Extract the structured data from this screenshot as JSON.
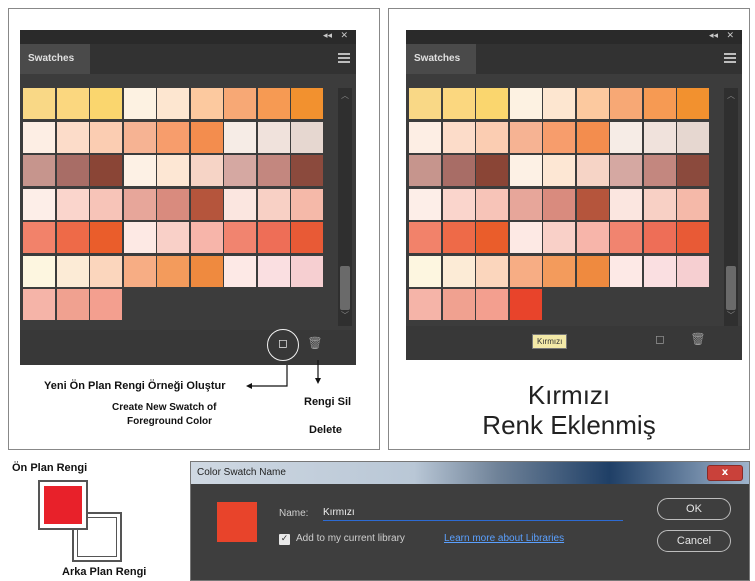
{
  "left_panel": {
    "tab_label": "Swatches",
    "ctrl_collapse": "◂◂",
    "ctrl_close": "✕",
    "swatches": [
      [
        "#f9d886",
        "#fbd77f",
        "#fad66e",
        "#fdf2e2",
        "#fde6d0",
        "#fcc99f",
        "#f7a875",
        "#f69a53",
        "#f2912f"
      ],
      [
        "#fdeee4",
        "#fcdcc9",
        "#fbcdb2",
        "#f6b393",
        "#f79d6c",
        "#f38d4e",
        "#f6ece6",
        "#f0e2dc",
        "#e6d7d0"
      ],
      [
        "#c6958d",
        "#a86d66",
        "#8a4536",
        "#fdf1e5",
        "#fde7d4",
        "#f6d4c6",
        "#d5a8a2",
        "#c3877f",
        "#8b4a3d"
      ],
      [
        "#fdeee8",
        "#fad5cc",
        "#f7c4b8",
        "#e7a69a",
        "#d98b7e",
        "#b5553c",
        "#fbe6e0",
        "#f8d0c5",
        "#f5b9a9"
      ],
      [
        "#f2826a",
        "#ee6a48",
        "#ea5d2b",
        "#fde9e4",
        "#f9d0c8",
        "#f7b5aa",
        "#f1846f",
        "#ee6e57",
        "#e85a36"
      ],
      [
        "#fdf6e0",
        "#fcebd6",
        "#fbd6bd",
        "#f7ad84",
        "#f39b5c",
        "#ef8a3f",
        "#fde9e6",
        "#fadfe1",
        "#f6cfd1"
      ],
      [
        "#f5b4a8",
        "#f0a190",
        "#f39f8f"
      ]
    ],
    "circle_icon": "new-swatch"
  },
  "right_panel": {
    "tab_label": "Swatches",
    "ctrl_collapse": "◂◂",
    "ctrl_close": "✕",
    "swatches": [
      [
        "#f9d886",
        "#fbd77f",
        "#fad66e",
        "#fdf2e2",
        "#fde6d0",
        "#fcc99f",
        "#f7a875",
        "#f69a53",
        "#f2912f"
      ],
      [
        "#fdeee4",
        "#fcdcc9",
        "#fbcdb2",
        "#f6b393",
        "#f79d6c",
        "#f38d4e",
        "#f6ece6",
        "#f0e2dc",
        "#e6d7d0"
      ],
      [
        "#c6958d",
        "#a86d66",
        "#8a4536",
        "#fdf1e5",
        "#fde7d4",
        "#f6d4c6",
        "#d5a8a2",
        "#c3877f",
        "#8b4a3d"
      ],
      [
        "#fdeee8",
        "#fad5cc",
        "#f7c4b8",
        "#e7a69a",
        "#d98b7e",
        "#b5553c",
        "#fbe6e0",
        "#f8d0c5",
        "#f5b9a9"
      ],
      [
        "#f2826a",
        "#ee6a48",
        "#ea5d2b",
        "#fde9e4",
        "#f9d0c8",
        "#f7b5aa",
        "#f1846f",
        "#ee6e57",
        "#e85a36"
      ],
      [
        "#fdf6e0",
        "#fcebd6",
        "#fbd6bd",
        "#f7ad84",
        "#f39b5c",
        "#ef8a3f",
        "#fde9e6",
        "#fadfe1",
        "#f6cfd1"
      ],
      [
        "#f5b4a8",
        "#f0a190",
        "#f39f8f",
        "#e8442b"
      ]
    ],
    "tooltip": "Kırmızı"
  },
  "annotations": {
    "create_tr": "Yeni Ön Plan Rengi Örneği Oluştur",
    "create_en_line1": "Create New Swatch of",
    "create_en_line2": "Foreground Color",
    "delete_tr": "Rengi Sil",
    "delete_en": "Delete",
    "added_line1": "Kırmızı",
    "added_line2": "Renk Eklenmiş",
    "foreground_label": "Ön Plan Rengi",
    "background_label": "Arka Plan Rengi"
  },
  "colors": {
    "foreground": "#e8212a",
    "background": "#ffffff",
    "new_swatch": "#e8442b"
  },
  "dialog": {
    "title": "Color Swatch Name",
    "close": "x",
    "name_label": "Name:",
    "name_value": "Kırmızı",
    "checkbox_label": "Add to my current library",
    "link": "Learn more about Libraries",
    "ok": "OK",
    "cancel": "Cancel"
  }
}
